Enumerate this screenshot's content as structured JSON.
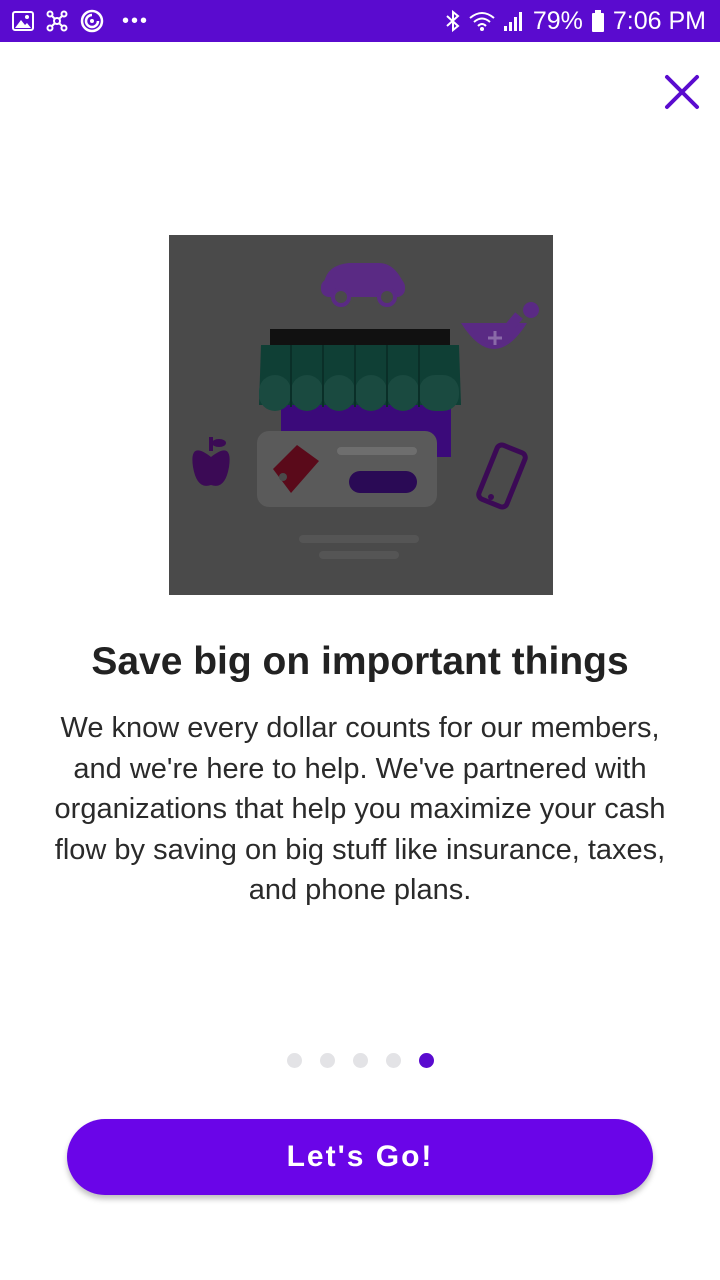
{
  "status_bar": {
    "battery": "79%",
    "time": "7:06 PM",
    "overflow": "•••",
    "icons_left": [
      "gallery-icon",
      "network-icon",
      "sync-icon"
    ],
    "icons_right": [
      "bluetooth-icon",
      "wifi-icon",
      "signal-icon",
      "battery-icon"
    ]
  },
  "header": {
    "close_icon": "close-icon",
    "close_color": "#5a0bcf"
  },
  "hero": {
    "illustration": "storefront-with-car-mortar-apple-tag-phone"
  },
  "content": {
    "title": "Save big on important things",
    "body": "We know every dollar counts for our members, and we're here to help. We've partnered with organizations that help you maximize your cash flow by saving on big stuff like insurance, taxes, and phone plans."
  },
  "pager": {
    "page_count": 5,
    "current_page": 5
  },
  "cta": {
    "label": "Let's Go!",
    "color": "#6a05e8"
  },
  "colors": {
    "brand": "#5a0bcf",
    "accent": "#6a05e8",
    "text": "#222222"
  }
}
